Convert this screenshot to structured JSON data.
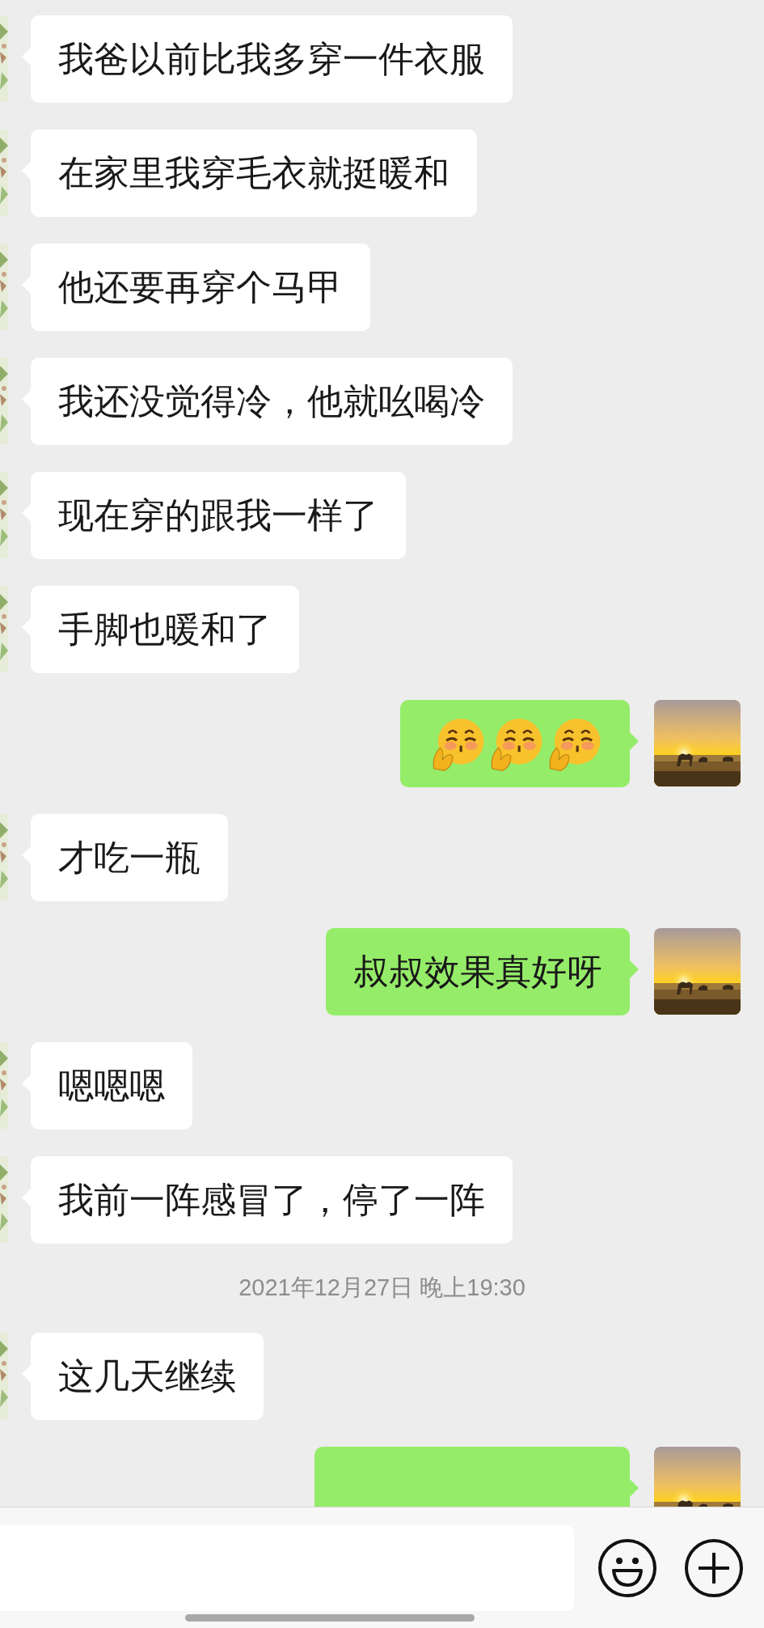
{
  "messages": [
    {
      "kind": "text",
      "outgoing": false,
      "text": "我爸以前比我多穿一件衣服"
    },
    {
      "kind": "text",
      "outgoing": false,
      "text": "在家里我穿毛衣就挺暖和"
    },
    {
      "kind": "text",
      "outgoing": false,
      "text": "他还要再穿个马甲"
    },
    {
      "kind": "text",
      "outgoing": false,
      "text": "我还没觉得冷，他就吆喝冷"
    },
    {
      "kind": "text",
      "outgoing": false,
      "text": "现在穿的跟我一样了"
    },
    {
      "kind": "text",
      "outgoing": false,
      "text": "手脚也暖和了"
    },
    {
      "kind": "emoji",
      "outgoing": true,
      "emojis": [
        {
          "kind": "shy-face"
        },
        {
          "kind": "shy-face"
        },
        {
          "kind": "shy-face"
        }
      ]
    },
    {
      "kind": "text",
      "outgoing": false,
      "text": "才吃一瓶"
    },
    {
      "kind": "text",
      "outgoing": true,
      "text": "叔叔效果真好呀"
    },
    {
      "kind": "text",
      "outgoing": false,
      "text": "嗯嗯嗯"
    },
    {
      "kind": "text",
      "outgoing": false,
      "text": "我前一阵感冒了，停了一阵"
    },
    {
      "kind": "time",
      "text": "2021年12月27日 晚上19:30"
    },
    {
      "kind": "text",
      "outgoing": false,
      "text": "这几天继续"
    },
    {
      "kind": "cut",
      "outgoing": true
    }
  ]
}
